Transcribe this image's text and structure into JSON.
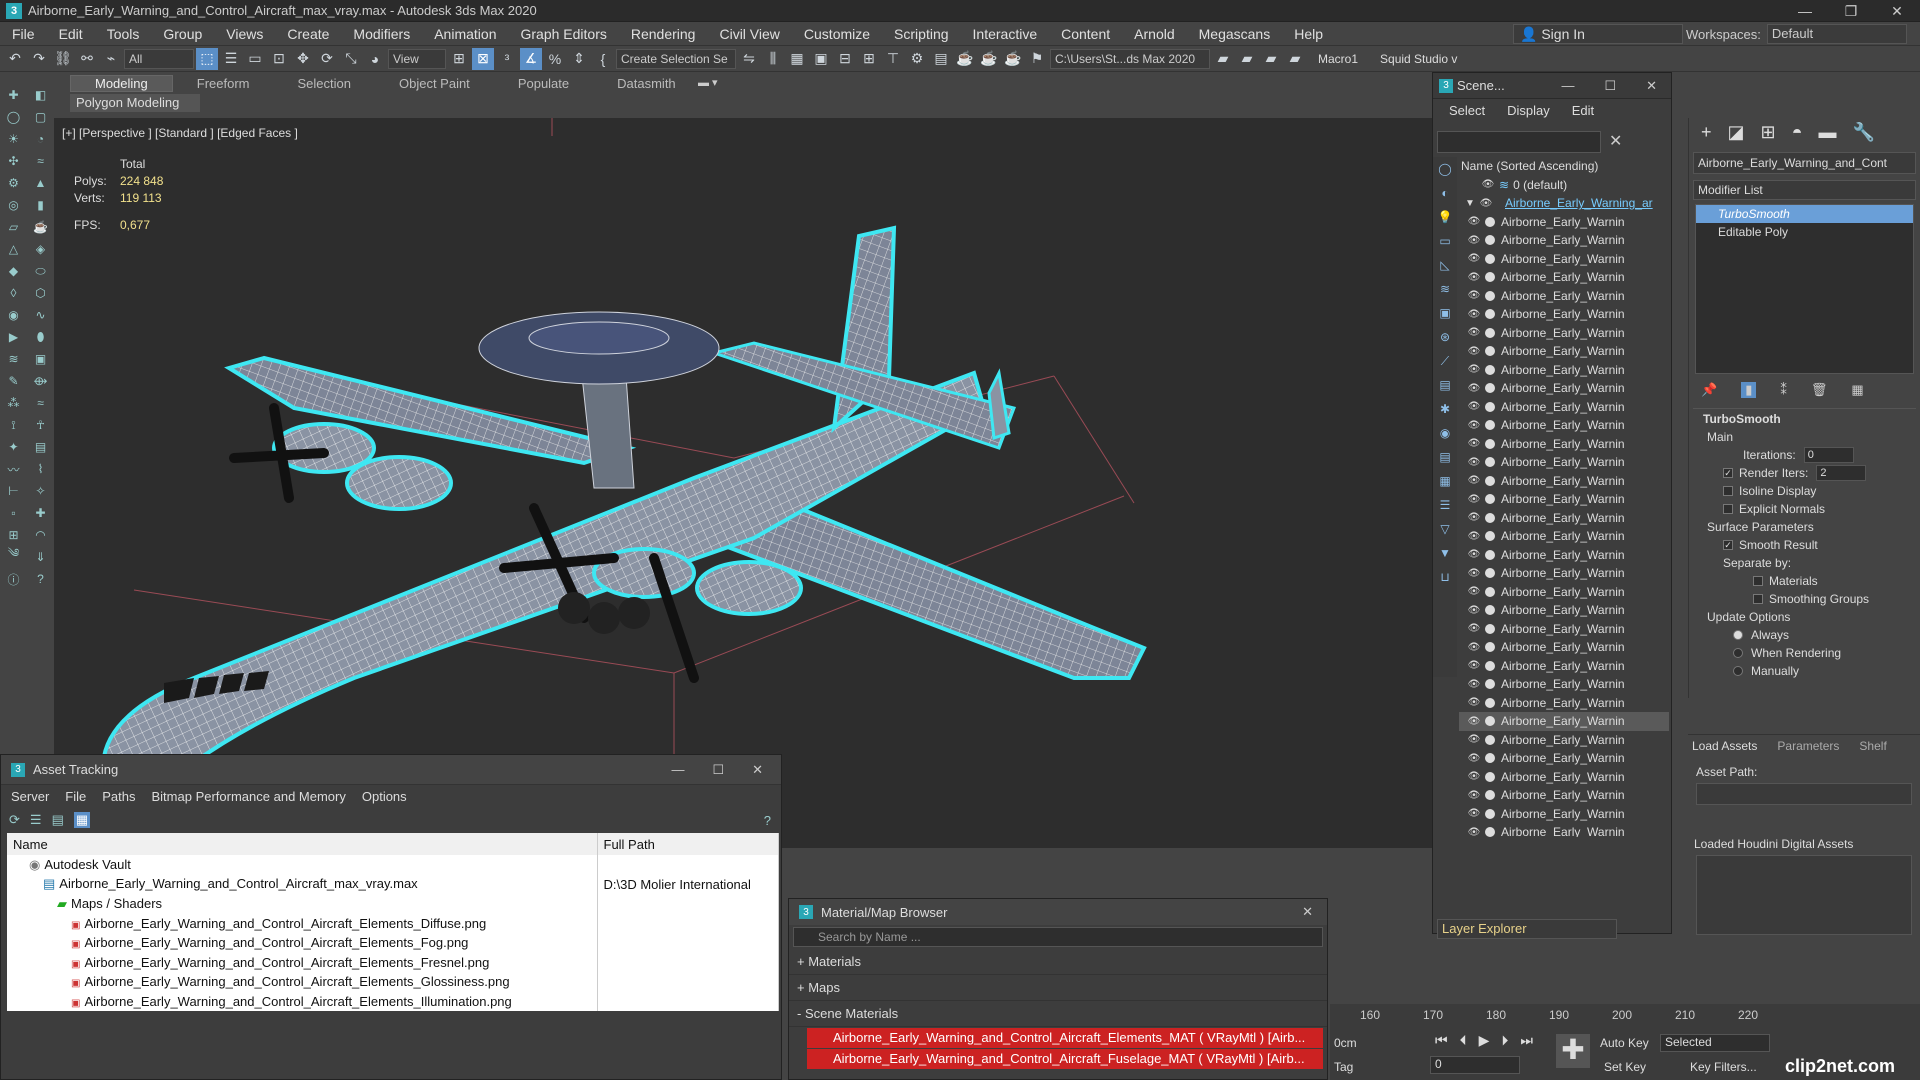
{
  "title": "Airborne_Early_Warning_and_Control_Aircraft_max_vray.max - Autodesk 3ds Max 2020",
  "menu": [
    "File",
    "Edit",
    "Tools",
    "Group",
    "Views",
    "Create",
    "Modifiers",
    "Animation",
    "Graph Editors",
    "Rendering",
    "Civil View",
    "Customize",
    "Scripting",
    "Interactive",
    "Content",
    "Arnold",
    "Megascans",
    "Help"
  ],
  "signin": "Sign In",
  "workspaces_label": "Workspaces:",
  "workspace": "Default",
  "toolbar": {
    "filter": "All",
    "view": "View",
    "selection_set": "Create Selection Se",
    "path": "C:\\Users\\St...ds Max 2020",
    "macro": "Macro1",
    "squid": "Squid Studio v"
  },
  "ribbon": {
    "tabs": [
      "Modeling",
      "Freeform",
      "Selection",
      "Object Paint",
      "Populate",
      "Datasmith"
    ],
    "sub": "Polygon Modeling"
  },
  "viewport": {
    "label": "[+] [Perspective ] [Standard ] [Edged Faces ]",
    "total": "Total",
    "polys_label": "Polys:",
    "polys": "224 848",
    "verts_label": "Verts:",
    "verts": "119 113",
    "fps_label": "FPS:",
    "fps": "0,677"
  },
  "scene": {
    "title": "Scene...",
    "menu": [
      "Select",
      "Display",
      "Edit"
    ],
    "col": "Name (Sorted Ascending)",
    "default": "0 (default)",
    "parent": "Airborne_Early_Warning_ar",
    "child": "Airborne_Early_Warnin",
    "footer": "Layer Explorer"
  },
  "cmd": {
    "object": "Airborne_Early_Warning_and_Cont",
    "modlist": "Modifier List",
    "stack": [
      "TurboSmooth",
      "Editable Poly"
    ],
    "roll": "TurboSmooth",
    "main": "Main",
    "iter_label": "Iterations:",
    "iter": "0",
    "render_label": "Render Iters:",
    "render": "2",
    "isoline": "Isoline Display",
    "explicit": "Explicit Normals",
    "surface": "Surface Parameters",
    "smooth": "Smooth Result",
    "separate": "Separate by:",
    "materials": "Materials",
    "smoothing": "Smoothing Groups",
    "update": "Update Options",
    "always": "Always",
    "when": "When Rendering",
    "manually": "Manually"
  },
  "houdini": {
    "tabs": [
      "Load Assets",
      "Parameters",
      "Shelf"
    ],
    "path": "Asset Path:",
    "loaded": "Loaded Houdini Digital Assets"
  },
  "asset": {
    "title": "Asset Tracking",
    "menu": [
      "Server",
      "File",
      "Paths",
      "Bitmap Performance and Memory",
      "Options"
    ],
    "col_name": "Name",
    "col_path": "Full Path",
    "rows": [
      {
        "name": "Autodesk Vault",
        "path": "",
        "indent": 1
      },
      {
        "name": "Airborne_Early_Warning_and_Control_Aircraft_max_vray.max",
        "path": "D:\\3D Molier International",
        "indent": 2
      },
      {
        "name": "Maps / Shaders",
        "path": "",
        "indent": 3
      },
      {
        "name": "Airborne_Early_Warning_and_Control_Aircraft_Elements_Diffuse.png",
        "path": "",
        "indent": 4
      },
      {
        "name": "Airborne_Early_Warning_and_Control_Aircraft_Elements_Fog.png",
        "path": "",
        "indent": 4
      },
      {
        "name": "Airborne_Early_Warning_and_Control_Aircraft_Elements_Fresnel.png",
        "path": "",
        "indent": 4
      },
      {
        "name": "Airborne_Early_Warning_and_Control_Aircraft_Elements_Glossiness.png",
        "path": "",
        "indent": 4
      },
      {
        "name": "Airborne_Early_Warning_and_Control_Aircraft_Elements_Illumination.png",
        "path": "",
        "indent": 4
      }
    ]
  },
  "matb": {
    "title": "Material/Map Browser",
    "search": "Search by Name ...",
    "sections": [
      "+ Materials",
      "+ Maps",
      "- Scene Materials"
    ],
    "mats": [
      "Airborne_Early_Warning_and_Control_Aircraft_Elements_MAT ( VRayMtl ) [Airb...",
      "Airborne_Early_Warning_and_Control_Aircraft_Fuselage_MAT ( VRayMtl ) [Airb..."
    ]
  },
  "timeline": {
    "ticks": [
      "160",
      "170",
      "180",
      "190",
      "200",
      "210",
      "220"
    ],
    "cm": "0cm",
    "tag": "Tag",
    "frame": "0",
    "autokey": "Auto Key",
    "setkey": "Set Key",
    "selected": "Selected",
    "keyfilters": "Key Filters...",
    "watermark": "clip2net.com"
  }
}
